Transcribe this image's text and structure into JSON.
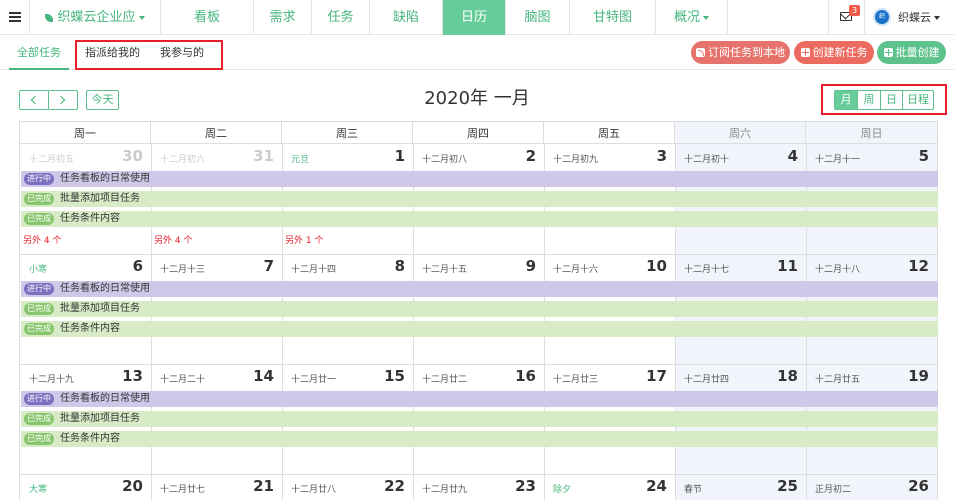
{
  "nav": {
    "project": "织蝶云企业应",
    "tabs": [
      "看板",
      "需求",
      "任务",
      "缺陷",
      "日历",
      "脑图",
      "甘特图",
      "概况"
    ],
    "active_tab": "日历",
    "mail_count": "3",
    "user_name": "织蝶云",
    "avatar_text": "织"
  },
  "subnav": {
    "tabs": [
      "全部任务",
      "指派给我的",
      "我参与的"
    ],
    "active_tab": "全部任务"
  },
  "actions": {
    "subscribe": "订阅任务到本地",
    "create": "创建新任务",
    "batch": "批量创建"
  },
  "toolbar": {
    "today": "今天",
    "title": "2020年 一月",
    "views": [
      "月",
      "周",
      "日",
      "日程"
    ],
    "active_view": "月"
  },
  "calendar": {
    "weekdays": [
      "周一",
      "周二",
      "周三",
      "周四",
      "周五",
      "周六",
      "周日"
    ],
    "weeks": [
      [
        {
          "day": "30",
          "lunar": "十二月初五",
          "other": true
        },
        {
          "day": "31",
          "lunar": "十二月初六",
          "other": true
        },
        {
          "day": "1",
          "lunar": "元旦",
          "festival": true
        },
        {
          "day": "2",
          "lunar": "十二月初八"
        },
        {
          "day": "3",
          "lunar": "十二月初九"
        },
        {
          "day": "4",
          "lunar": "十二月初十"
        },
        {
          "day": "5",
          "lunar": "十二月十一"
        }
      ],
      [
        {
          "day": "6",
          "lunar": "小寒",
          "festival": true
        },
        {
          "day": "7",
          "lunar": "十二月十三"
        },
        {
          "day": "8",
          "lunar": "十二月十四"
        },
        {
          "day": "9",
          "lunar": "十二月十五"
        },
        {
          "day": "10",
          "lunar": "十二月十六"
        },
        {
          "day": "11",
          "lunar": "十二月十七"
        },
        {
          "day": "12",
          "lunar": "十二月十八"
        }
      ],
      [
        {
          "day": "13",
          "lunar": "十二月十九"
        },
        {
          "day": "14",
          "lunar": "十二月二十"
        },
        {
          "day": "15",
          "lunar": "十二月廿一"
        },
        {
          "day": "16",
          "lunar": "十二月廿二"
        },
        {
          "day": "17",
          "lunar": "十二月廿三"
        },
        {
          "day": "18",
          "lunar": "十二月廿四"
        },
        {
          "day": "19",
          "lunar": "十二月廿五"
        }
      ],
      [
        {
          "day": "20",
          "lunar": "大寒",
          "festival": true
        },
        {
          "day": "21",
          "lunar": "十二月廿七"
        },
        {
          "day": "22",
          "lunar": "十二月廿八"
        },
        {
          "day": "23",
          "lunar": "十二月廿九"
        },
        {
          "day": "24",
          "lunar": "除夕",
          "festival": true
        },
        {
          "day": "25",
          "lunar": "春节"
        },
        {
          "day": "26",
          "lunar": "正月初二"
        }
      ]
    ],
    "events": [
      {
        "status": "进行中",
        "type": "doing",
        "title": "任务看板的日常使用"
      },
      {
        "status": "已完成",
        "type": "done",
        "title": "批量添加项目任务"
      },
      {
        "status": "已完成",
        "type": "done",
        "title": "任务条件内容"
      }
    ],
    "more": [
      "另外 4 个",
      "另外 4 个",
      "另外 1 个"
    ]
  },
  "colors": {
    "accent": "#66cc99",
    "accent_text": "#46b67e",
    "subscribe_bg": "#e5736b",
    "create_bg": "#ec6b60",
    "batch_bg": "#5dc28b",
    "highlight_box": "#e8202a"
  }
}
